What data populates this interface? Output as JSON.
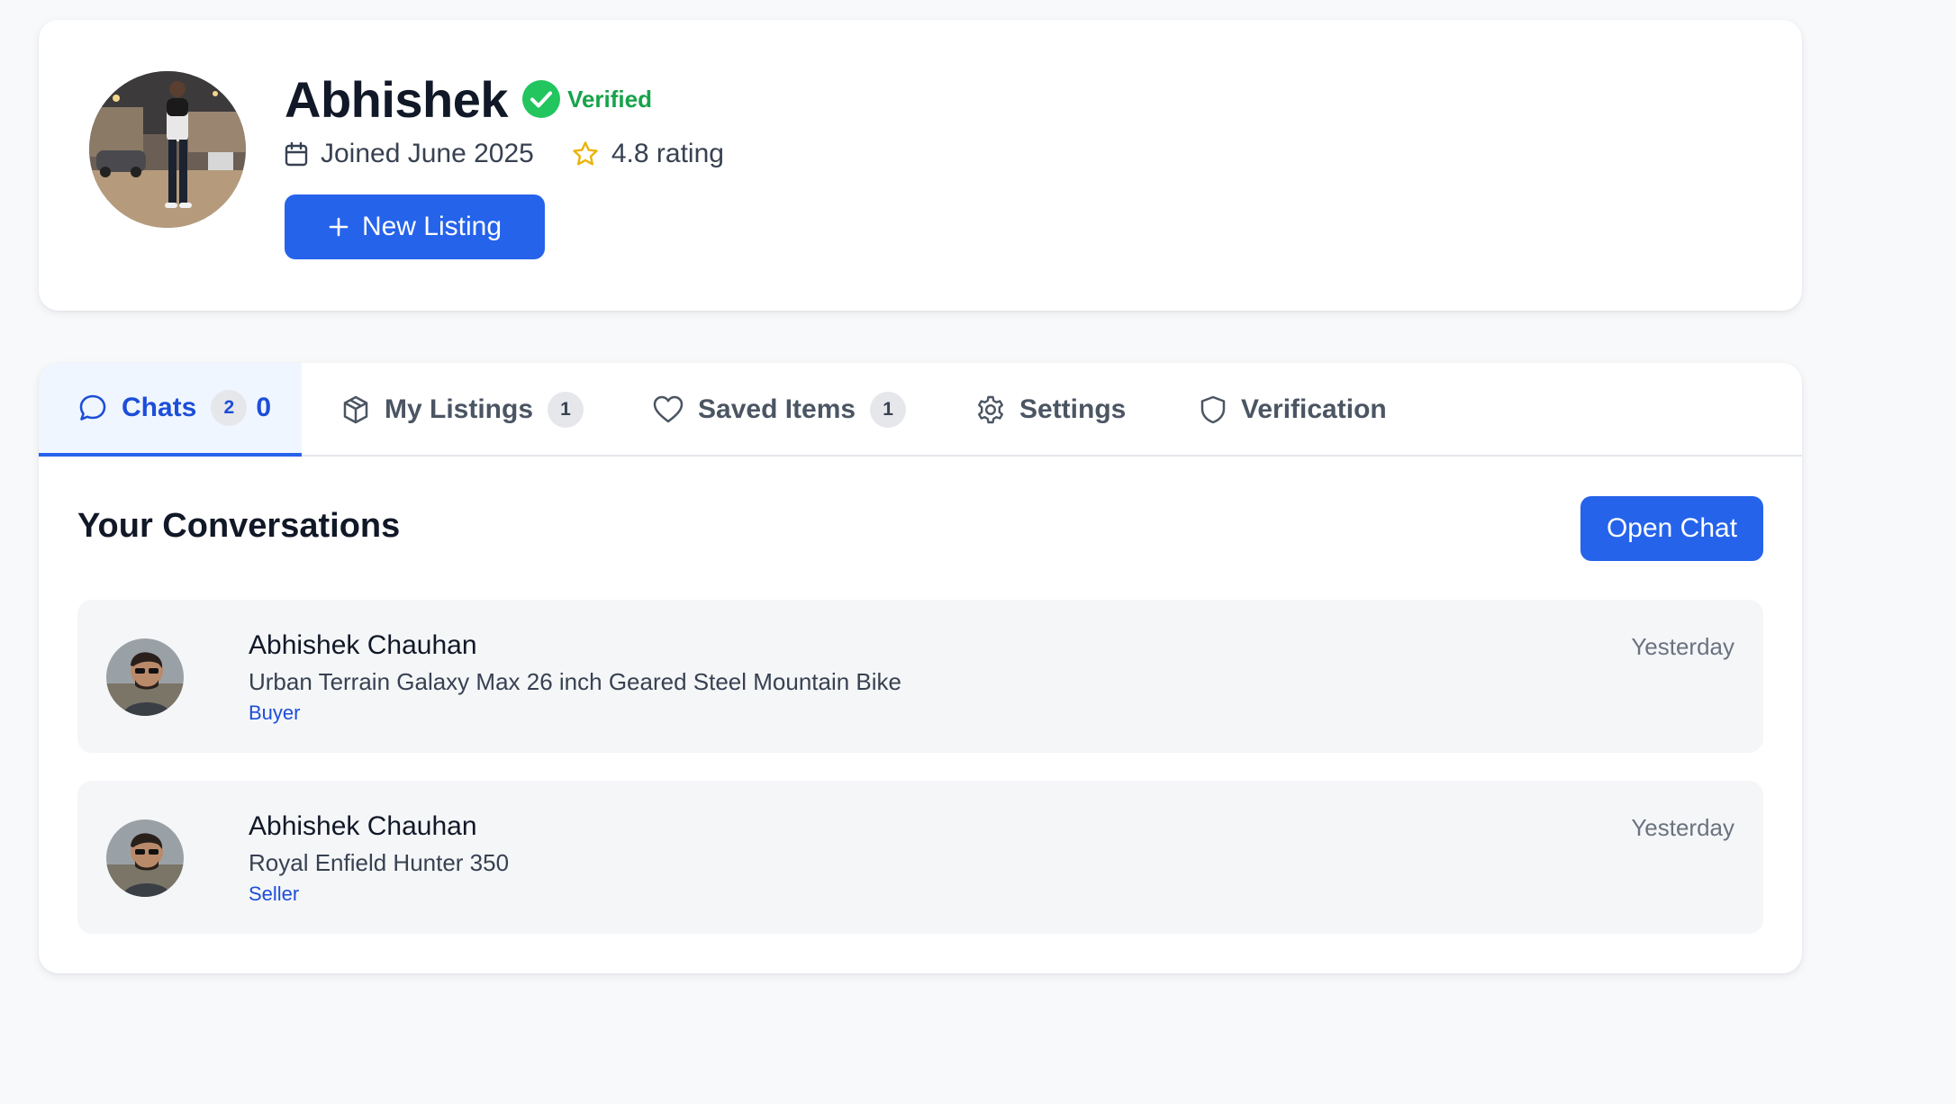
{
  "profile": {
    "name": "Abhishek",
    "verified_label": "Verified",
    "joined": "Joined June 2025",
    "rating": "4.8 rating",
    "new_listing_label": "New Listing"
  },
  "tabs": [
    {
      "label": "Chats",
      "badge": "2",
      "extra": "0",
      "icon": "chat-bubble-icon",
      "active": true
    },
    {
      "label": "My Listings",
      "badge": "1",
      "icon": "package-icon",
      "active": false
    },
    {
      "label": "Saved Items",
      "badge": "1",
      "icon": "heart-icon",
      "active": false
    },
    {
      "label": "Settings",
      "icon": "gear-icon",
      "active": false
    },
    {
      "label": "Verification",
      "icon": "shield-icon",
      "active": false
    }
  ],
  "conversations": {
    "title": "Your Conversations",
    "open_chat_label": "Open Chat",
    "items": [
      {
        "name": "Abhishek Chauhan",
        "listing": "Urban Terrain Galaxy Max 26 inch Geared Steel Mountain Bike",
        "role": "Buyer",
        "time": "Yesterday"
      },
      {
        "name": "Abhishek Chauhan",
        "listing": "Royal Enfield Hunter 350",
        "role": "Seller",
        "time": "Yesterday"
      }
    ]
  },
  "colors": {
    "accent": "#2563eb",
    "verified": "#16a34a",
    "star": "#eab308",
    "page_bg": "#f8f9fb"
  }
}
